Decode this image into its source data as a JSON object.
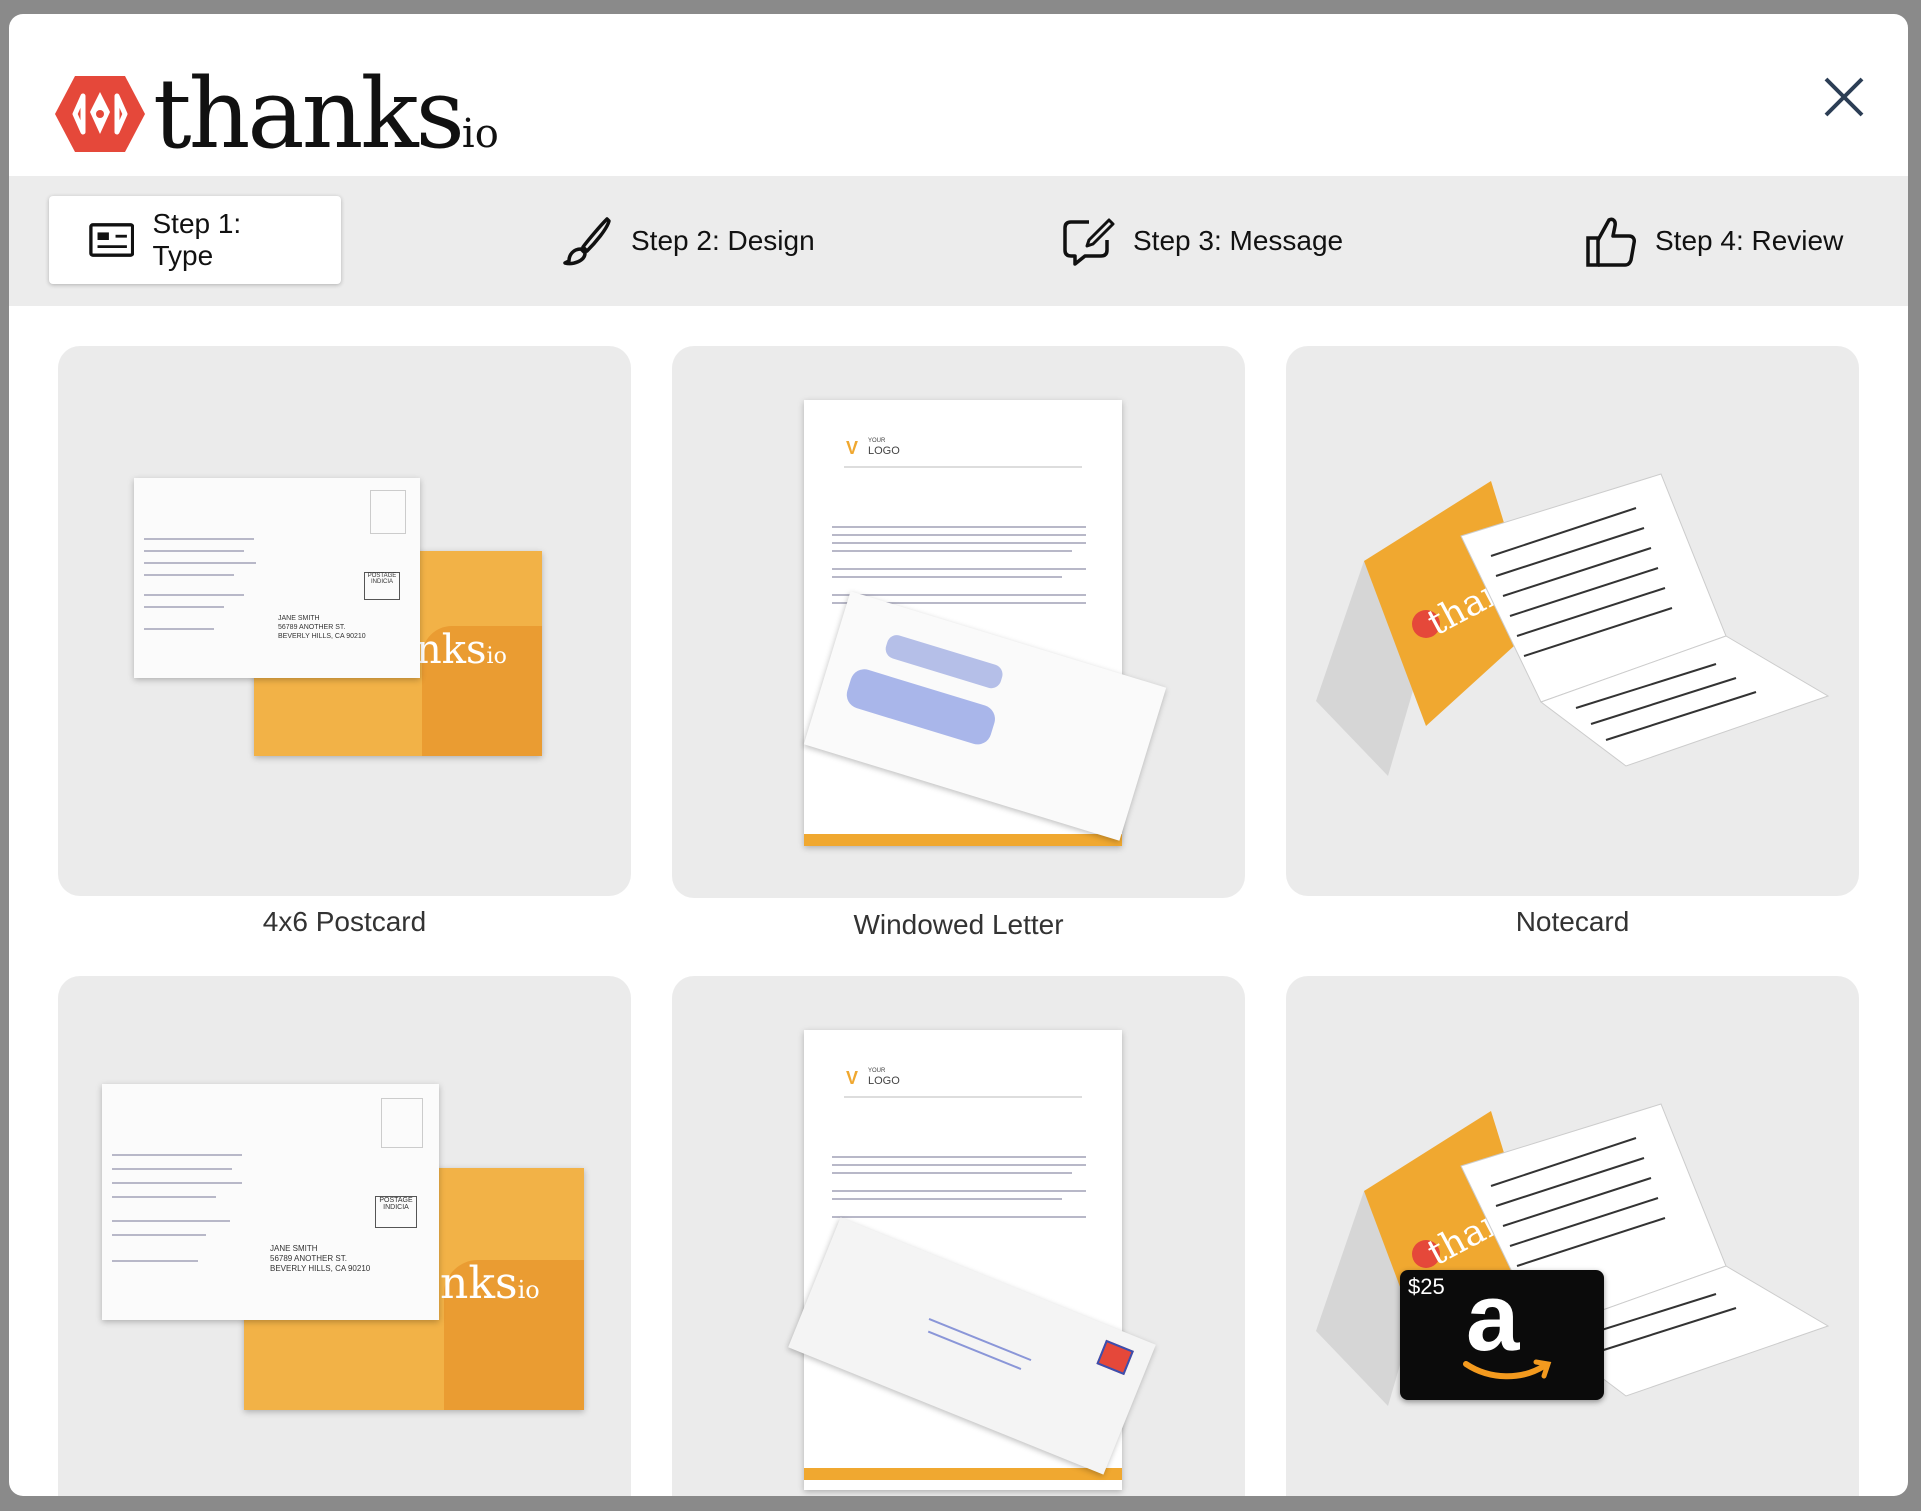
{
  "brand": {
    "name": "thanks",
    "suffix": "io",
    "primary_color": "#e5483a",
    "accent_color": "#f0ab2e"
  },
  "header": {
    "close_icon": "close-icon"
  },
  "steps": [
    {
      "label": "Step 1: Type",
      "icon": "card-type-icon",
      "active": true
    },
    {
      "label": "Step 2: Design",
      "icon": "brush-icon",
      "active": false
    },
    {
      "label": "Step 3: Message",
      "icon": "message-edit-icon",
      "active": false
    },
    {
      "label": "Step 4: Review",
      "icon": "thumbs-up-icon",
      "active": false
    }
  ],
  "mail_types": [
    {
      "label": "4x6 Postcard"
    },
    {
      "label": "Windowed Letter"
    },
    {
      "label": "Notecard"
    },
    {
      "label": ""
    },
    {
      "label": ""
    },
    {
      "label": ""
    }
  ],
  "postcard_preview": {
    "stamp_text": "POSTAGE INDICIA",
    "recipient_lines": [
      "JANE SMITH",
      "56789 ANOTHER ST.",
      "BEVERLY HILLS, CA 90210"
    ],
    "front_text": "nks",
    "front_suffix": "io"
  },
  "letter_preview": {
    "logo_small": "YOUR",
    "logo_text": "LOGO"
  },
  "notecard_preview": {
    "front_text": "thank"
  },
  "giftcard_preview": {
    "amount": "$25",
    "brand_letter": "a"
  }
}
